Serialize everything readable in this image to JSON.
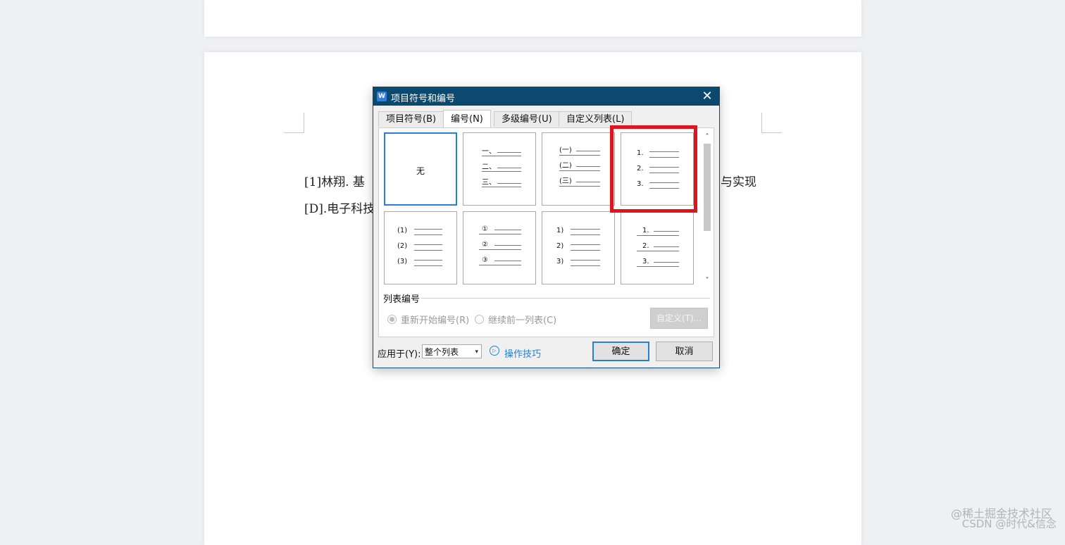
{
  "document": {
    "line1_left": "[1]林翔. 基",
    "line1_right": "与实现",
    "line2_left": "[D].电子科技"
  },
  "dialog": {
    "title": "项目符号和编号",
    "app_icon": "W",
    "close_glyph": "✕",
    "tabs": [
      "项目符号(B)",
      "编号(N)",
      "多级编号(U)",
      "自定义列表(L)"
    ],
    "active_tab": "编号(N)",
    "gallery": {
      "none_label": "无",
      "styles": [
        {
          "markers": [
            "一、",
            "二、",
            "三、"
          ]
        },
        {
          "markers": [
            "(一)",
            "(二)",
            "(三)"
          ]
        },
        {
          "markers": [
            "1.",
            "2.",
            "3."
          ]
        },
        {
          "markers": [
            "(1)",
            "(2)",
            "(3)"
          ]
        },
        {
          "markers": [
            "①",
            "②",
            "③"
          ]
        },
        {
          "markers": [
            "1)",
            "2)",
            "3)"
          ]
        },
        {
          "markers": [
            "1.",
            "2.",
            "3."
          ]
        }
      ]
    },
    "scroll_up_glyph": "˄",
    "scroll_down_glyph": "˅",
    "list_section_label": "列表编号",
    "radio_restart": "重新开始编号(R)",
    "radio_continue": "继续前一列表(C)",
    "custom_button": "自定义(T)...",
    "apply_label": "应用于(Y):",
    "apply_value": "整个列表",
    "select_caret": "▾",
    "tips_icon": "▷",
    "tips_link": "操作技巧",
    "ok_button": "确定",
    "cancel_button": "取消"
  },
  "watermark": {
    "line1": "@稀土掘金技术社区",
    "line2": "CSDN @时代&信念"
  },
  "colors": {
    "titlebar": "#0b4a6e",
    "accent": "#2a7fd4",
    "highlight": "#e0141c"
  }
}
